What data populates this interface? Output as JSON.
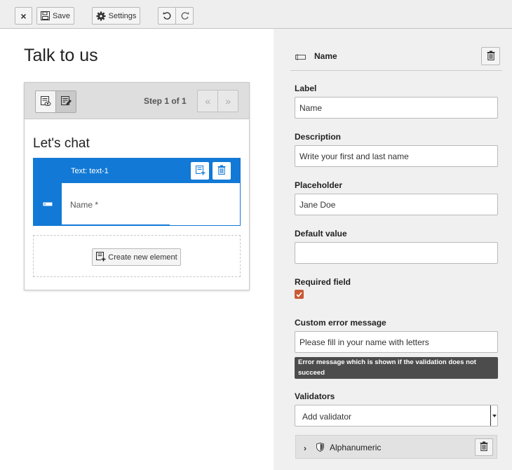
{
  "toolbar": {
    "close_label": "×",
    "save_label": "Save",
    "settings_label": "Settings",
    "icons": {
      "save": "save-icon",
      "settings": "gear-icon",
      "undo": "undo-icon",
      "redo": "redo-icon"
    }
  },
  "stage": {
    "title": "Talk to us",
    "step_label": "Step 1 of 1",
    "page_heading": "Let's chat",
    "element": {
      "type_label": "Text: text-1",
      "field_label": "Name *"
    },
    "create_button_label": "Create new element",
    "accent": "#1279d6"
  },
  "inspector": {
    "title": "Name",
    "fields": {
      "label": {
        "label": "Label",
        "value": "Name"
      },
      "description": {
        "label": "Description",
        "value": "Write your first and last name"
      },
      "placeholder": {
        "label": "Placeholder",
        "value": "Jane Doe"
      },
      "default_value": {
        "label": "Default value",
        "value": ""
      },
      "required": {
        "label": "Required field",
        "checked": true
      },
      "error_message": {
        "label": "Custom error message",
        "value": "Please fill in your name with letters"
      },
      "error_hint": "Error message which is shown if the validation does not succeed"
    },
    "validators": {
      "label": "Validators",
      "select_value": "Add validator",
      "items": [
        {
          "name": "Alphanumeric"
        }
      ]
    },
    "checkbox_color": "#c95a36"
  }
}
